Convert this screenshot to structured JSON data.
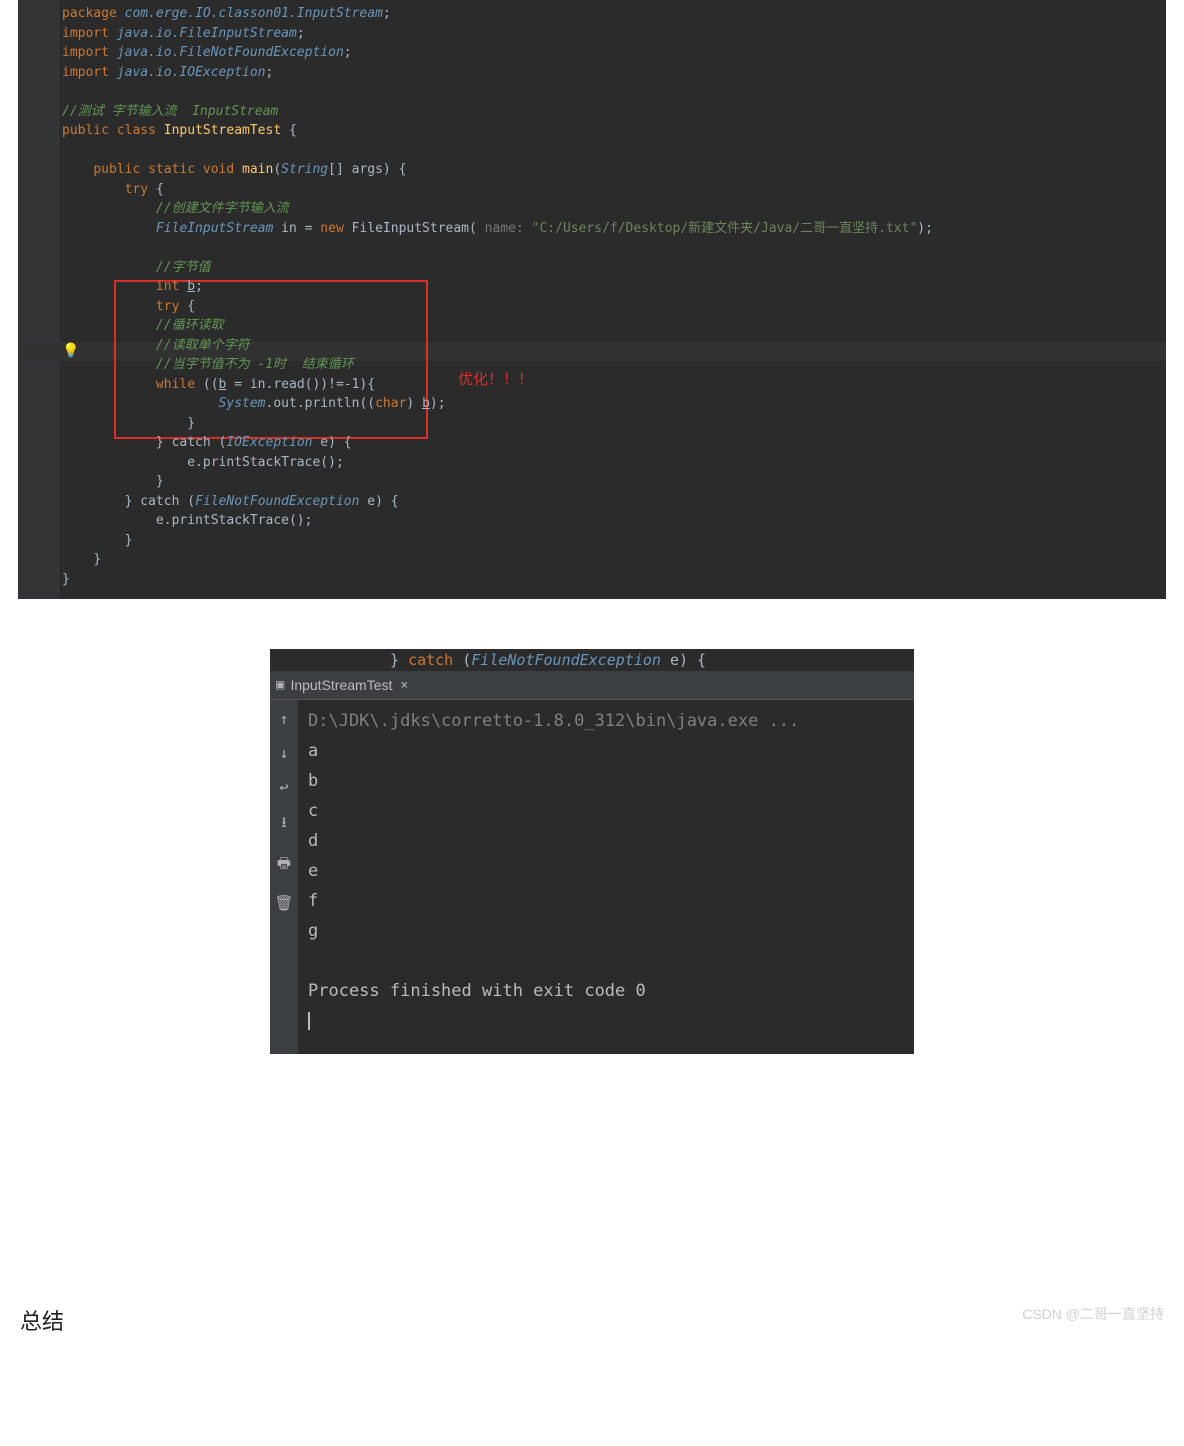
{
  "code": {
    "package_kw": "package ",
    "package_val": "com.erge.IO.classon01.InputStream",
    "import_kw": "import ",
    "imp1": "java.io.FileInputStream",
    "imp2": "java.io.FileNotFoundException",
    "imp3": "java.io.IOException",
    "cmt_test": "//测试 字节输入流  InputStream",
    "pub": "public ",
    "cls_kw": "class ",
    "cls_name": "InputStreamTest ",
    "brace_open": "{",
    "brace_close": "}",
    "static_void": "static void ",
    "main": "main",
    "paren_open": "(",
    "paren_close": ")",
    "string_arr": "String",
    "arr_args": "[] args) {",
    "try_kw": "try ",
    "cmt_create": "//创建文件字节输入流",
    "fis": "FileInputStream ",
    "in_eq": "in = ",
    "new_kw": "new ",
    "fis_ctor": "FileInputStream( ",
    "name_hint": "name: ",
    "path_str": "\"C:/Users/f/Desktop/新建文件夹/Java/二哥一直坚持.txt\"",
    "close_call": ");",
    "cmt_byte": "//字节值",
    "int_kw": "int ",
    "b_var": "b",
    "semi": ";",
    "cmt_loop": "//循环读取",
    "cmt_read1": "//读取单个字符",
    "cmt_when": "//当字节值不为 -1时  结束循环",
    "while_kw": "while ",
    "while_cond_a": "((",
    "while_cond_b": " = in.read())!=-1){",
    "system": "System",
    "out": ".out",
    "println": ".println((",
    "char_kw": "char",
    "println_end": ") ",
    "println_close": ");",
    "catch_kw": "} catch (",
    "ioex": "IOException ",
    "e_brace": "e) {",
    "print_stack": "e.printStackTrace();",
    "fnfe": "FileNotFoundException "
  },
  "annotation": {
    "label": "优化！！！"
  },
  "console": {
    "topfrag_a": "} ",
    "topfrag_catch": "catch ",
    "topfrag_paren": "(",
    "topfrag_ex": "FileNotFoundException ",
    "topfrag_e": "e) {",
    "tabname": "InputStreamTest",
    "cmd": "D:\\JDK\\.jdks\\corretto-1.8.0_312\\bin\\java.exe ...",
    "lines": [
      "a",
      "b",
      "c",
      "d",
      "e",
      "f",
      "g"
    ],
    "exit": "Process finished with exit code 0"
  },
  "footer": {
    "heading": "总结",
    "watermark": "CSDN @二哥一直坚持"
  }
}
